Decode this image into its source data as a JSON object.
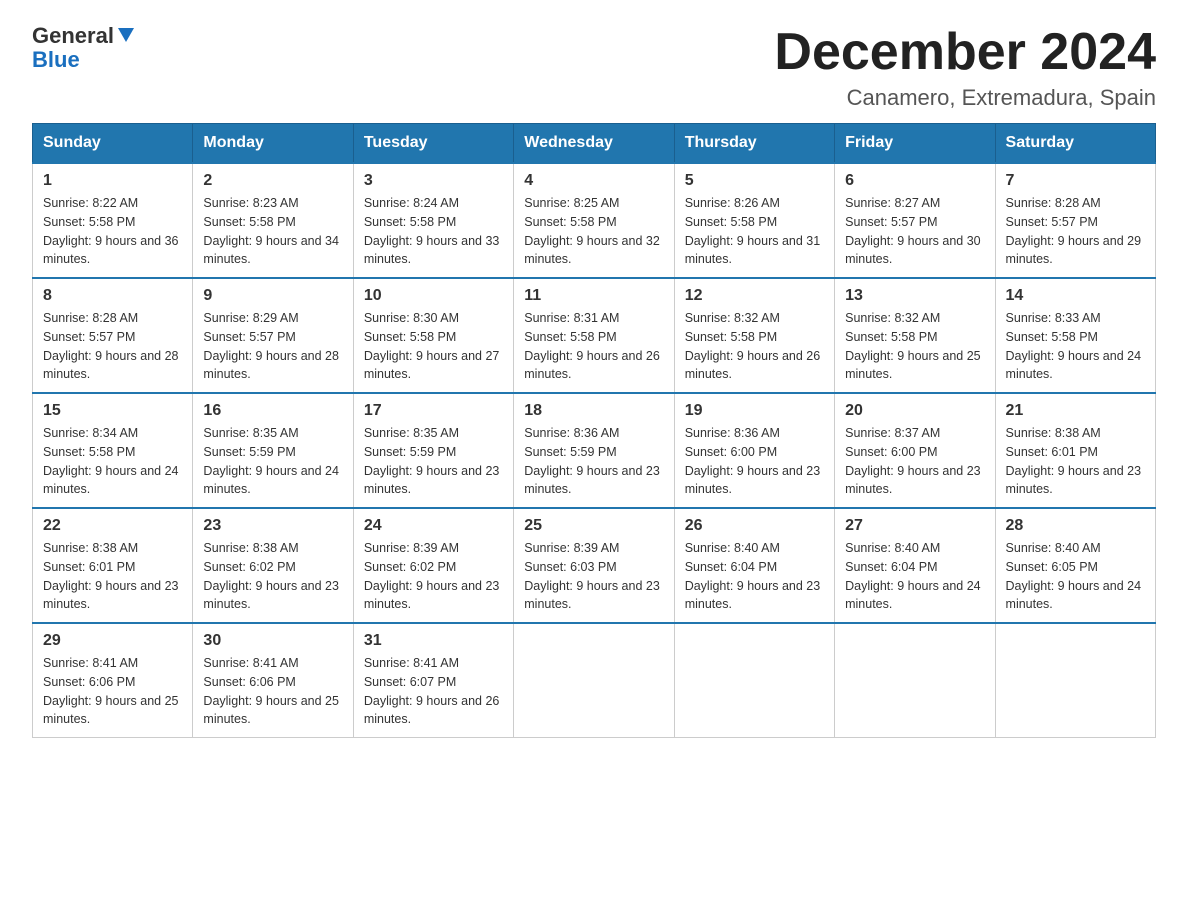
{
  "logo": {
    "line1": "General",
    "arrow": true,
    "line2": "Blue"
  },
  "title": "December 2024",
  "subtitle": "Canamero, Extremadura, Spain",
  "weekdays": [
    "Sunday",
    "Monday",
    "Tuesday",
    "Wednesday",
    "Thursday",
    "Friday",
    "Saturday"
  ],
  "weeks": [
    [
      {
        "day": "1",
        "sunrise": "8:22 AM",
        "sunset": "5:58 PM",
        "daylight": "9 hours and 36 minutes."
      },
      {
        "day": "2",
        "sunrise": "8:23 AM",
        "sunset": "5:58 PM",
        "daylight": "9 hours and 34 minutes."
      },
      {
        "day": "3",
        "sunrise": "8:24 AM",
        "sunset": "5:58 PM",
        "daylight": "9 hours and 33 minutes."
      },
      {
        "day": "4",
        "sunrise": "8:25 AM",
        "sunset": "5:58 PM",
        "daylight": "9 hours and 32 minutes."
      },
      {
        "day": "5",
        "sunrise": "8:26 AM",
        "sunset": "5:58 PM",
        "daylight": "9 hours and 31 minutes."
      },
      {
        "day": "6",
        "sunrise": "8:27 AM",
        "sunset": "5:57 PM",
        "daylight": "9 hours and 30 minutes."
      },
      {
        "day": "7",
        "sunrise": "8:28 AM",
        "sunset": "5:57 PM",
        "daylight": "9 hours and 29 minutes."
      }
    ],
    [
      {
        "day": "8",
        "sunrise": "8:28 AM",
        "sunset": "5:57 PM",
        "daylight": "9 hours and 28 minutes."
      },
      {
        "day": "9",
        "sunrise": "8:29 AM",
        "sunset": "5:57 PM",
        "daylight": "9 hours and 28 minutes."
      },
      {
        "day": "10",
        "sunrise": "8:30 AM",
        "sunset": "5:58 PM",
        "daylight": "9 hours and 27 minutes."
      },
      {
        "day": "11",
        "sunrise": "8:31 AM",
        "sunset": "5:58 PM",
        "daylight": "9 hours and 26 minutes."
      },
      {
        "day": "12",
        "sunrise": "8:32 AM",
        "sunset": "5:58 PM",
        "daylight": "9 hours and 26 minutes."
      },
      {
        "day": "13",
        "sunrise": "8:32 AM",
        "sunset": "5:58 PM",
        "daylight": "9 hours and 25 minutes."
      },
      {
        "day": "14",
        "sunrise": "8:33 AM",
        "sunset": "5:58 PM",
        "daylight": "9 hours and 24 minutes."
      }
    ],
    [
      {
        "day": "15",
        "sunrise": "8:34 AM",
        "sunset": "5:58 PM",
        "daylight": "9 hours and 24 minutes."
      },
      {
        "day": "16",
        "sunrise": "8:35 AM",
        "sunset": "5:59 PM",
        "daylight": "9 hours and 24 minutes."
      },
      {
        "day": "17",
        "sunrise": "8:35 AM",
        "sunset": "5:59 PM",
        "daylight": "9 hours and 23 minutes."
      },
      {
        "day": "18",
        "sunrise": "8:36 AM",
        "sunset": "5:59 PM",
        "daylight": "9 hours and 23 minutes."
      },
      {
        "day": "19",
        "sunrise": "8:36 AM",
        "sunset": "6:00 PM",
        "daylight": "9 hours and 23 minutes."
      },
      {
        "day": "20",
        "sunrise": "8:37 AM",
        "sunset": "6:00 PM",
        "daylight": "9 hours and 23 minutes."
      },
      {
        "day": "21",
        "sunrise": "8:38 AM",
        "sunset": "6:01 PM",
        "daylight": "9 hours and 23 minutes."
      }
    ],
    [
      {
        "day": "22",
        "sunrise": "8:38 AM",
        "sunset": "6:01 PM",
        "daylight": "9 hours and 23 minutes."
      },
      {
        "day": "23",
        "sunrise": "8:38 AM",
        "sunset": "6:02 PM",
        "daylight": "9 hours and 23 minutes."
      },
      {
        "day": "24",
        "sunrise": "8:39 AM",
        "sunset": "6:02 PM",
        "daylight": "9 hours and 23 minutes."
      },
      {
        "day": "25",
        "sunrise": "8:39 AM",
        "sunset": "6:03 PM",
        "daylight": "9 hours and 23 minutes."
      },
      {
        "day": "26",
        "sunrise": "8:40 AM",
        "sunset": "6:04 PM",
        "daylight": "9 hours and 23 minutes."
      },
      {
        "day": "27",
        "sunrise": "8:40 AM",
        "sunset": "6:04 PM",
        "daylight": "9 hours and 24 minutes."
      },
      {
        "day": "28",
        "sunrise": "8:40 AM",
        "sunset": "6:05 PM",
        "daylight": "9 hours and 24 minutes."
      }
    ],
    [
      {
        "day": "29",
        "sunrise": "8:41 AM",
        "sunset": "6:06 PM",
        "daylight": "9 hours and 25 minutes."
      },
      {
        "day": "30",
        "sunrise": "8:41 AM",
        "sunset": "6:06 PM",
        "daylight": "9 hours and 25 minutes."
      },
      {
        "day": "31",
        "sunrise": "8:41 AM",
        "sunset": "6:07 PM",
        "daylight": "9 hours and 26 minutes."
      },
      null,
      null,
      null,
      null
    ]
  ],
  "labels": {
    "sunrise": "Sunrise:",
    "sunset": "Sunset:",
    "daylight": "Daylight:"
  }
}
